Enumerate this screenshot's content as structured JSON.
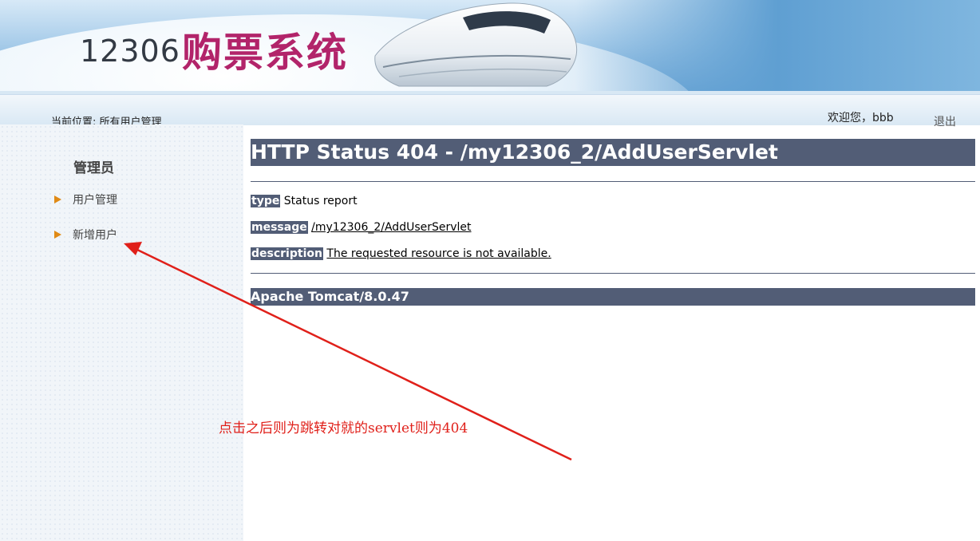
{
  "banner": {
    "logo_number": "12306",
    "logo_text": "购票系统"
  },
  "topbar": {
    "breadcrumb": "当前位置: 所有用户管理",
    "welcome": "欢迎您，bbb",
    "logout": "退出"
  },
  "sidebar": {
    "title": "管理员",
    "items": [
      {
        "label": "用户管理"
      },
      {
        "label": "新增用户"
      }
    ]
  },
  "error_page": {
    "heading": "HTTP Status 404 - /my12306_2/AddUserServlet",
    "type_label": "type",
    "type_value": "Status report",
    "message_label": "message",
    "message_value": "/my12306_2/AddUserServlet",
    "description_label": "description",
    "description_value": "The requested resource is not available.",
    "server": "Apache Tomcat/8.0.47"
  },
  "annotation": {
    "text": "点击之后则为跳转对就的servlet则为404",
    "color": "#e0201a"
  },
  "colors": {
    "tomcat_bar": "#525d76",
    "logo_magenta": "#b2246a",
    "sidebar_arrow": "#e08a16"
  }
}
